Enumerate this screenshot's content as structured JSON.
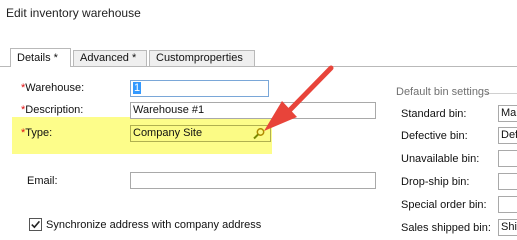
{
  "window": {
    "title": "Edit inventory warehouse"
  },
  "tabs": [
    {
      "label": "Details *",
      "active": true
    },
    {
      "label": "Advanced *",
      "active": false
    },
    {
      "label": "Customproperties",
      "active": false
    }
  ],
  "form": {
    "warehouse": {
      "asterisk": "*",
      "label": "Warehouse:",
      "value": "1"
    },
    "description": {
      "asterisk": "*",
      "label": "Description:",
      "value": "Warehouse #1"
    },
    "type": {
      "asterisk": "*",
      "label": "Type:",
      "value": "Company Site"
    },
    "email": {
      "label": "Email:",
      "value": ""
    },
    "sync_address": {
      "label": "Synchronize address with company address",
      "checked": true
    }
  },
  "default_bins": {
    "title": "Default bin settings",
    "rows": [
      {
        "label": "Standard bin:",
        "value": "Mai"
      },
      {
        "label": "Defective bin:",
        "value": "Defe"
      },
      {
        "label": "Unavailable bin:",
        "value": ""
      },
      {
        "label": "Drop-ship bin:",
        "value": ""
      },
      {
        "label": "Special order bin:",
        "value": ""
      },
      {
        "label": "Sales shipped bin:",
        "value": "Ship"
      }
    ]
  },
  "colors": {
    "highlight": "#fdfd8a",
    "required": "#e01010",
    "annotation_arrow": "#e8443a",
    "selection": "#3399ff"
  },
  "icons": {
    "type_lookup": "magnifier-icon",
    "sync_check": "check-icon"
  }
}
